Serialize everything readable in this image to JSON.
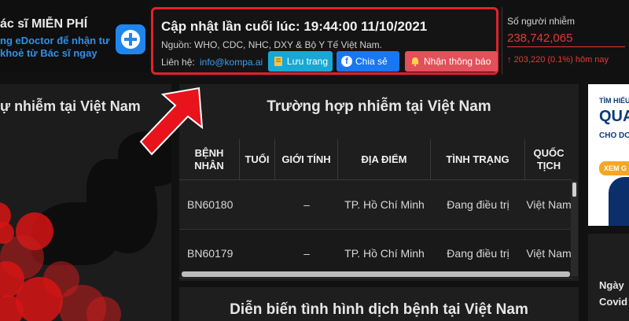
{
  "promo": {
    "line1": "ác sĩ MIỄN PHÍ",
    "line2": "ng eDoctor để nhận tư",
    "line3": "khoẻ từ Bác sĩ ngay",
    "icon": "medical-cross-icon"
  },
  "update": {
    "title": "Cập nhật lần cuối lúc: 19:44:00 11/10/2021",
    "source": "Nguồn: WHO, CDC, NHC, DXY & Bộ Y Tế Việt Nam.",
    "contact_label": "Liên hệ:",
    "contact_email": "info@kompa.ai",
    "save_label": "Lưu trang",
    "share_label": "Chia sẻ",
    "notify_label": "Nhận thông báo"
  },
  "stats": {
    "label": "Số người nhiễm",
    "total": "238,742,065",
    "delta": "203,220 (0.1%) hôm nay",
    "accent": "#e53935"
  },
  "map": {
    "title": "nhiễm tại Việt Nam",
    "title_prefix": "ự"
  },
  "table": {
    "title": "Trường hợp nhiễm tại Việt Nam",
    "headers": [
      "BỆNH NHÂN",
      "TUỔI",
      "GIỚI TÍNH",
      "ĐỊA ĐIỂM",
      "TÌNH TRẠNG",
      "QUỐC TỊCH"
    ],
    "rows": [
      {
        "patient": "BN60180",
        "age": "",
        "gender": "–",
        "location": "TP. Hồ Chí Minh",
        "status": "Đang điều trị",
        "nationality": "Việt Nam"
      },
      {
        "patient": "BN60179",
        "age": "",
        "gender": "–",
        "location": "TP. Hồ Chí Minh",
        "status": "Đang điều trị",
        "nationality": "Việt Nam"
      }
    ]
  },
  "development": {
    "title": "Diễn biến tình hình dịch bệnh tại Việt Nam"
  },
  "ad": {
    "t1": "TÌM HIỂU",
    "t2": "QUA",
    "t3": "CHO DO",
    "button": "XEM G"
  },
  "news": {
    "line1": "Ngày",
    "line2": "Covid"
  }
}
